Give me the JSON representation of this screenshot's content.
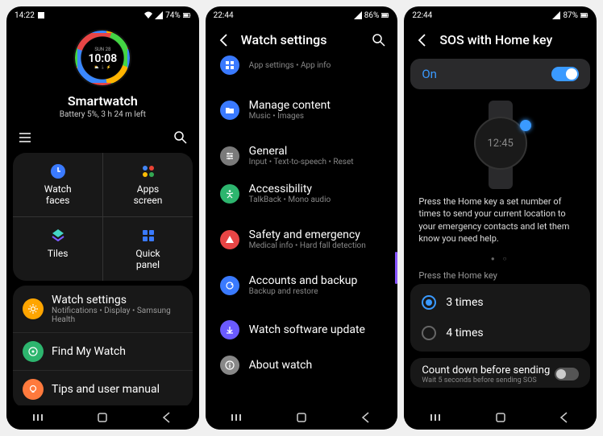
{
  "screen1": {
    "status": {
      "time": "14:22",
      "battery": "74%"
    },
    "watchface": {
      "day": "SUN 28",
      "time": "10:08"
    },
    "device_name": "Smartwatch",
    "battery_line": "Battery 5%, 3 h 24 m left",
    "grid": [
      {
        "label": "Watch\nfaces",
        "icon": "watchface-icon",
        "color": "#3a7aff"
      },
      {
        "label": "Apps\nscreen",
        "icon": "apps-icon",
        "color": "#34a853"
      },
      {
        "label": "Tiles",
        "icon": "tiles-icon",
        "color": "#7b5cff"
      },
      {
        "label": "Quick\npanel",
        "icon": "quickpanel-icon",
        "color": "#3a7aff"
      }
    ],
    "items": [
      {
        "title": "Watch settings",
        "subtitle": "Notifications • Display • Samsung Health",
        "color": "#ffa500"
      },
      {
        "title": "Find My Watch",
        "subtitle": "",
        "color": "#2db56e"
      },
      {
        "title": "Tips and user manual",
        "subtitle": "",
        "color": "#ff7a3d"
      }
    ]
  },
  "screen2": {
    "status": {
      "time": "22:44",
      "battery": "86%"
    },
    "title": "Watch settings",
    "items": [
      {
        "title": "",
        "subtitle": "App settings • App info",
        "color": "#3a7aff"
      },
      {
        "title": "Manage content",
        "subtitle": "Music • Images",
        "color": "#3a7aff"
      },
      {
        "title": "General",
        "subtitle": "Input • Text-to-speech • Reset",
        "color": "#7a7a7a"
      },
      {
        "title": "Accessibility",
        "subtitle": "TalkBack • Mono audio",
        "color": "#2db56e"
      },
      {
        "title": "Safety and emergency",
        "subtitle": "Medical info • Hard fall detection",
        "color": "#e84545"
      },
      {
        "title": "Accounts and backup",
        "subtitle": "Backup and restore",
        "color": "#3a7aff"
      },
      {
        "title": "Watch software update",
        "subtitle": "",
        "color": "#6a5aff"
      },
      {
        "title": "About watch",
        "subtitle": "",
        "color": "#888888"
      }
    ]
  },
  "screen3": {
    "status": {
      "time": "22:44",
      "battery": "87%"
    },
    "title": "SOS with Home key",
    "toggle_label": "On",
    "watch_time": "12:45",
    "description": "Press the Home key a set number of times to send your current location to your emergency contacts and let them know you need help.",
    "section_label": "Press the Home key",
    "options": [
      {
        "label": "3 times",
        "selected": true
      },
      {
        "label": "4 times",
        "selected": false
      }
    ],
    "countdown": {
      "title": "Count down before sending",
      "subtitle": "Wait 5 seconds before sending SOS"
    }
  }
}
